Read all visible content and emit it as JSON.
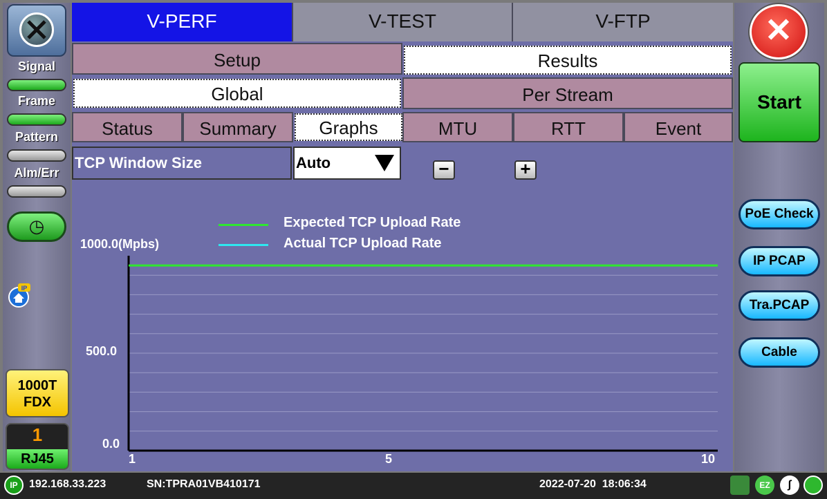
{
  "left_panel": {
    "indicators": [
      {
        "label": "Signal",
        "state": "green"
      },
      {
        "label": "Frame",
        "state": "green"
      },
      {
        "label": "Pattern",
        "state": "grey"
      },
      {
        "label": "Alm/Err",
        "state": "grey"
      }
    ],
    "history_icon": "clock-icon",
    "ip_badge": "IP",
    "speed": {
      "line1": "1000T",
      "line2": "FDX"
    },
    "port": {
      "number": "1",
      "label": "RJ45"
    }
  },
  "top_tabs": [
    {
      "label": "V-PERF",
      "active": true
    },
    {
      "label": "V-TEST",
      "active": false
    },
    {
      "label": "V-FTP",
      "active": false
    }
  ],
  "sub_tabs": [
    {
      "label": "Setup",
      "selected": false
    },
    {
      "label": "Results",
      "selected": true
    }
  ],
  "view_tabs": [
    {
      "label": "Global",
      "selected": true
    },
    {
      "label": "Per Stream",
      "selected": false
    }
  ],
  "result_tabs": [
    {
      "label": "Status",
      "selected": false
    },
    {
      "label": "Summary",
      "selected": false
    },
    {
      "label": "Graphs",
      "selected": true
    },
    {
      "label": "MTU",
      "selected": false
    },
    {
      "label": "RTT",
      "selected": false
    },
    {
      "label": "Event",
      "selected": false
    }
  ],
  "graph_controls": {
    "field_label": "TCP Window Size",
    "dropdown_value": "Auto",
    "zoom_out": "−",
    "zoom_in": "+"
  },
  "chart_data": {
    "type": "line",
    "series": [
      {
        "name": "Expected TCP Upload Rate",
        "color": "#2ee82e",
        "x": [
          1,
          10
        ],
        "values": [
          950,
          950
        ]
      },
      {
        "name": "Actual TCP Upload Rate",
        "color": "#2ee8f0",
        "x": [],
        "values": []
      }
    ],
    "y_ticks": [
      {
        "value": 1000,
        "label": "1000.0(Mpbs)"
      },
      {
        "value": 500,
        "label": "500.0"
      },
      {
        "value": 0,
        "label": "0.0"
      }
    ],
    "x_ticks": [
      {
        "value": 1,
        "label": "1"
      },
      {
        "value": 5,
        "label": "5"
      },
      {
        "value": 10,
        "label": "10"
      }
    ],
    "xlim": [
      1,
      10
    ],
    "ylim": [
      0,
      1000
    ],
    "grid": true,
    "legend_placement": "top"
  },
  "right_panel": {
    "close_icon": "close-icon",
    "start_label": "Start",
    "buttons": [
      "PoE Check",
      "IP PCAP",
      "Tra.PCAP",
      "Cable"
    ]
  },
  "status_bar": {
    "ip_badge": "IP",
    "ip_address": "192.168.33.223",
    "serial": "SN:TPRA01VB410171",
    "datetime": "2022-07-20  18:06:34",
    "icons": [
      "network-icon",
      "ez-icon",
      "bluetooth-icon",
      "wifi-icon"
    ]
  }
}
